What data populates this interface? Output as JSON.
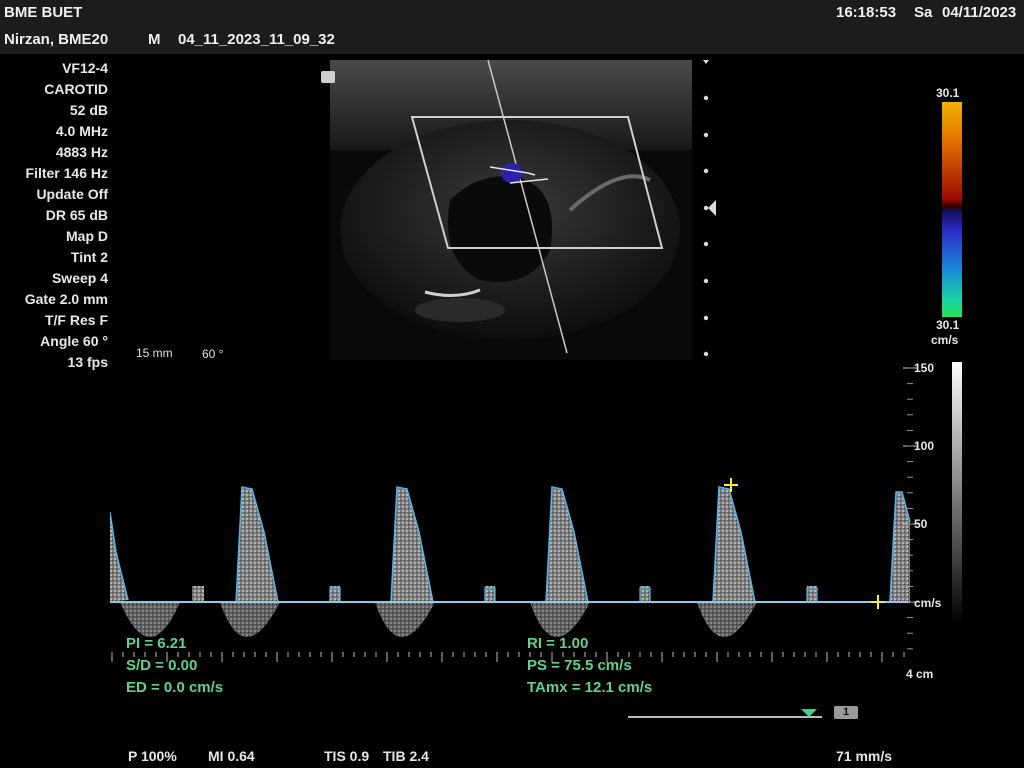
{
  "header": {
    "institution": "BME BUET",
    "patient": "Nirzan, BME20",
    "sex": "M",
    "study_id": "04_11_2023_11_09_32",
    "time": "16:18:53",
    "day": "Sa",
    "date": "04/11/2023"
  },
  "params": [
    "VF12-4",
    "CAROTID",
    "52 dB",
    "4.0 MHz",
    "4883 Hz",
    "Filter 146 Hz",
    "Update Off",
    "DR 65 dB",
    "Map D",
    "Tint 2",
    "Sweep 4",
    "Gate 2.0 mm",
    "T/F Res F",
    "Angle 60 °",
    "13 fps"
  ],
  "image_info": {
    "depth": "15 mm",
    "angle": "60 °"
  },
  "color_bar": {
    "top": "30.1",
    "bottom": "30.1",
    "unit": "cm/s"
  },
  "velocity_scale": {
    "labels": [
      "150",
      "100",
      "50",
      "cm/s"
    ],
    "unit_bottom": "4 cm"
  },
  "measurements": {
    "pi": "PI = 6.21",
    "sd": "S/D = 0.00",
    "ed": "ED = 0.0 cm/s",
    "ri": "RI = 1.00",
    "ps": "PS = 75.5 cm/s",
    "tamx": "TAmx = 12.1 cm/s"
  },
  "footer": {
    "power": "P 100%",
    "mi": "MI 0.64",
    "tis": "TIS 0.9",
    "tib": "TIB 2.4",
    "sweep_speed": "71 mm/s",
    "page_badge": "1"
  },
  "colors": {
    "measure_green": "#5fd38a",
    "trace_blue": "#4fb6e8",
    "cursor_yellow": "#ffee33"
  }
}
